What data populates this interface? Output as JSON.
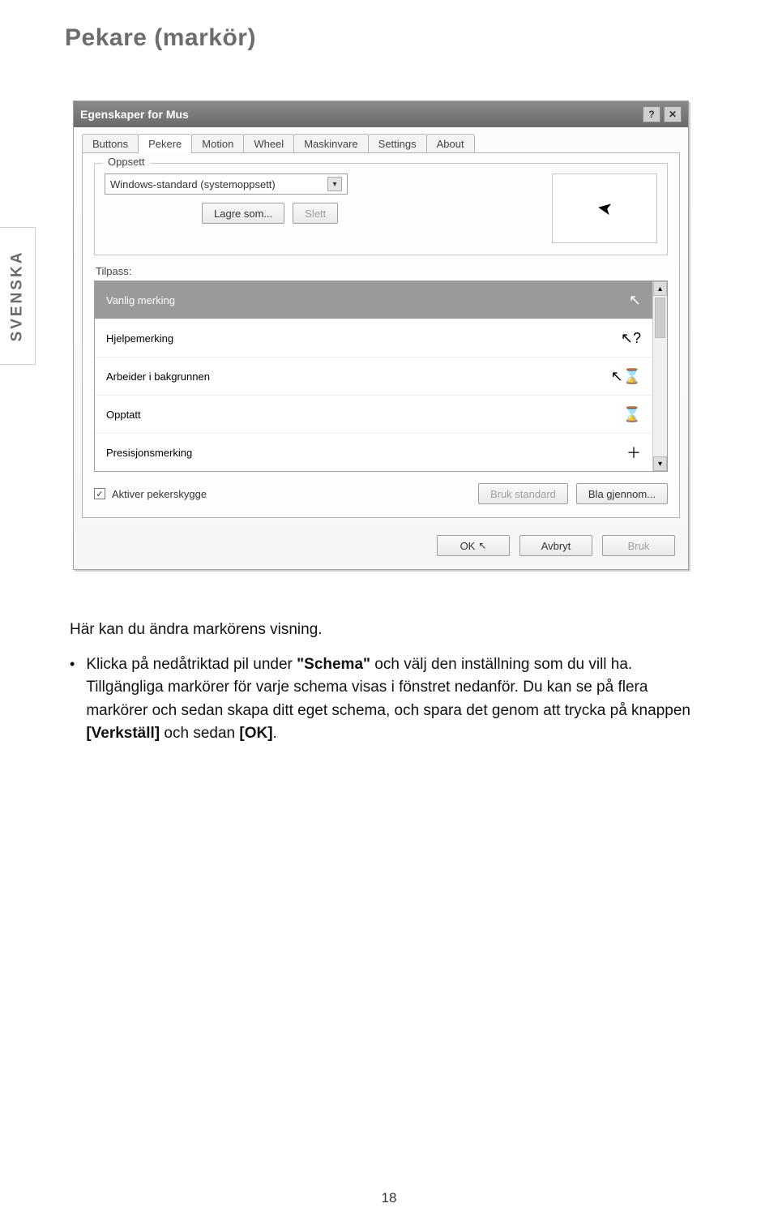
{
  "page": {
    "title": "Pekare (markör)",
    "side_tab": "SVENSKA",
    "number": "18"
  },
  "dialog": {
    "title": "Egenskaper for Mus",
    "help_icon": "?",
    "close_icon": "✕",
    "tabs": [
      "Buttons",
      "Pekere",
      "Motion",
      "Wheel",
      "Maskinvare",
      "Settings",
      "About"
    ],
    "active_tab_index": 1,
    "scheme": {
      "legend": "Oppsett",
      "dropdown_value": "Windows-standard (systemoppsett)",
      "save_as": "Lagre som...",
      "delete": "Slett"
    },
    "customize_label": "Tilpass:",
    "list": [
      {
        "label": "Vanlig merking",
        "icon": "↖",
        "selected": true
      },
      {
        "label": "Hjelpemerking",
        "icon": "↖?",
        "selected": false
      },
      {
        "label": "Arbeider i bakgrunnen",
        "icon": "↖⌛",
        "selected": false
      },
      {
        "label": "Opptatt",
        "icon": "⌛",
        "selected": false
      },
      {
        "label": "Presisjonsmerking",
        "icon": "＋",
        "selected": false
      }
    ],
    "shadow_checkbox": {
      "checked": true,
      "label": "Aktiver pekerskygge"
    },
    "use_default": "Bruk standard",
    "browse": "Bla gjennom...",
    "footer": {
      "ok": "OK",
      "cancel": "Avbryt",
      "apply": "Bruk"
    }
  },
  "text": {
    "intro": "Här kan du ändra markörens visning.",
    "bullet_pre": "Klicka på nedåtriktad pil under ",
    "bullet_b1": "\"Schema\"",
    "bullet_mid1": " och välj den inställning som du vill ha. Tillgängliga markörer för varje schema visas i fönstret nedanför. Du kan se på flera markörer och sedan skapa ditt eget schema, och spara det genom att trycka på knappen ",
    "bullet_b2": "[Verkställ]",
    "bullet_mid2": " och sedan ",
    "bullet_b3": "[OK]",
    "bullet_end": "."
  }
}
